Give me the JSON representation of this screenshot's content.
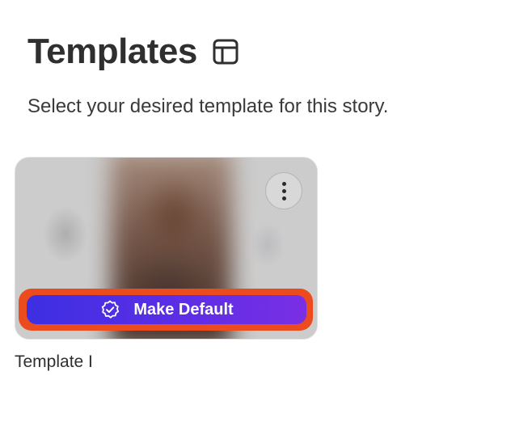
{
  "page": {
    "title": "Templates",
    "subtitle": "Select your desired template for this story."
  },
  "template_card": {
    "name": "Template I",
    "make_default_label": "Make Default"
  },
  "icons": {
    "title_icon": "layout-icon",
    "menu_icon": "more-vertical-icon",
    "make_default_icon": "badge-check-icon"
  },
  "colors": {
    "button_gradient_start": "#3d2fe2",
    "button_gradient_end": "#7a2fe3",
    "highlight": "#ec4b1d"
  }
}
